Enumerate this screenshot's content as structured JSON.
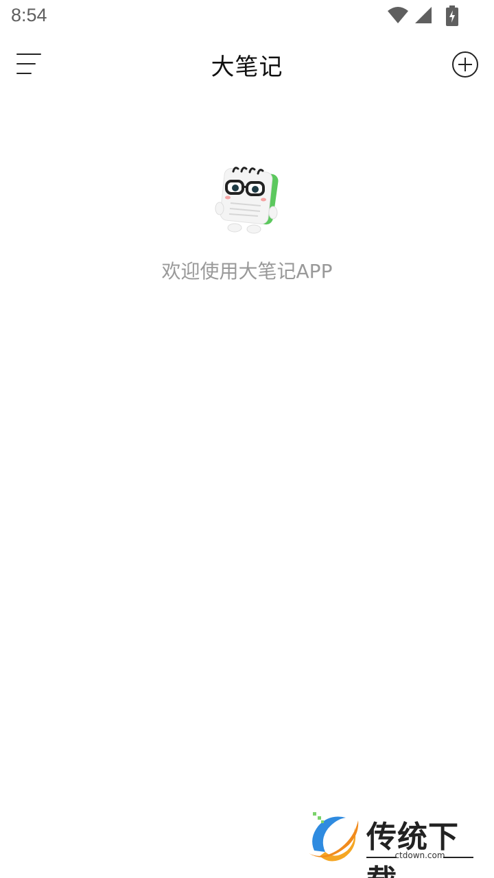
{
  "status_bar": {
    "time": "8:54"
  },
  "app_bar": {
    "title": "大笔记",
    "menu_icon": "menu-icon",
    "add_icon": "add-circle-icon"
  },
  "empty_state": {
    "illustration": "notebook-mascot-icon",
    "message": "欢迎使用大笔记APP"
  },
  "watermark": {
    "title": "传统下载",
    "url": "ctdown.com"
  },
  "colors": {
    "title_text": "#111111",
    "empty_text": "#999999",
    "status_icons": "#5f5f5f",
    "mascot_green": "#5cc85e"
  }
}
